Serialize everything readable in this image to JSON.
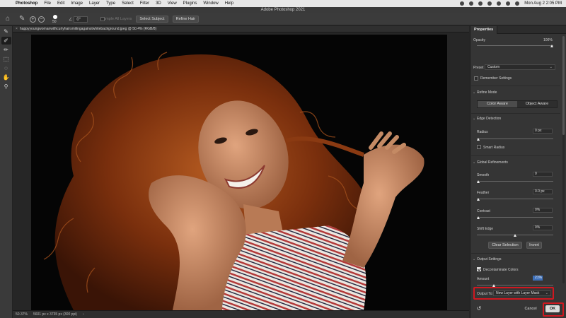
{
  "menubar": {
    "app_name": "Photoshop",
    "items": [
      "File",
      "Edit",
      "Image",
      "Layer",
      "Type",
      "Select",
      "Filter",
      "3D",
      "View",
      "Plugins",
      "Window",
      "Help"
    ],
    "clock": "Mon Aug 2  2:05 PM"
  },
  "window": {
    "title": "Adobe Photoshop 2021"
  },
  "options_bar": {
    "brush_size": "50",
    "angle_value": "0°",
    "sample_all_layers_label": "Sample All Layers",
    "select_subject_label": "Select Subject",
    "refine_hair_label": "Refine Hair"
  },
  "document": {
    "tab_title": "happyyoungwomanwithcurlyhairsmilingagainstwhitebackground.jpeg @ 50.4% (RGB/8)"
  },
  "status_bar": {
    "zoom": "50.37%",
    "dimensions": "5601 px x 3735 px (300 ppi)"
  },
  "properties": {
    "tab_label": "Properties",
    "opacity_label": "Opacity",
    "opacity_value": "100%",
    "opacity_level": 1.0,
    "preset_label": "Preset",
    "preset_value": "Custom",
    "remember_settings_label": "Remember Settings",
    "refine_mode_label": "Refine Mode",
    "color_aware_label": "Color Aware",
    "object_aware_label": "Object Aware",
    "edge_detection_label": "Edge Detection",
    "radius_label": "Radius",
    "radius_value": "0 px",
    "smart_radius_label": "Smart Radius",
    "global_refinements_label": "Global Refinements",
    "smooth_label": "Smooth",
    "smooth_value": "0",
    "feather_label": "Feather",
    "feather_value": "0.0 px",
    "contrast_label": "Contrast",
    "contrast_value": "0%",
    "shift_edge_label": "Shift Edge",
    "shift_edge_value": "0%",
    "clear_selection_label": "Clear Selection",
    "invert_label": "Invert",
    "output_settings_label": "Output Settings",
    "decontaminate_label": "Decontaminate Colors",
    "amount_label": "Amount",
    "amount_value": "21%",
    "amount_level": 0.21,
    "output_to_label": "Output To:",
    "output_to_value": "New Layer with Layer Mask",
    "cancel_label": "Cancel",
    "ok_label": "OK"
  },
  "colors": {
    "highlight_red": "#d01820",
    "hair": "#8a3a12",
    "skin": "#c98f6a",
    "background_photo": "#050505"
  }
}
